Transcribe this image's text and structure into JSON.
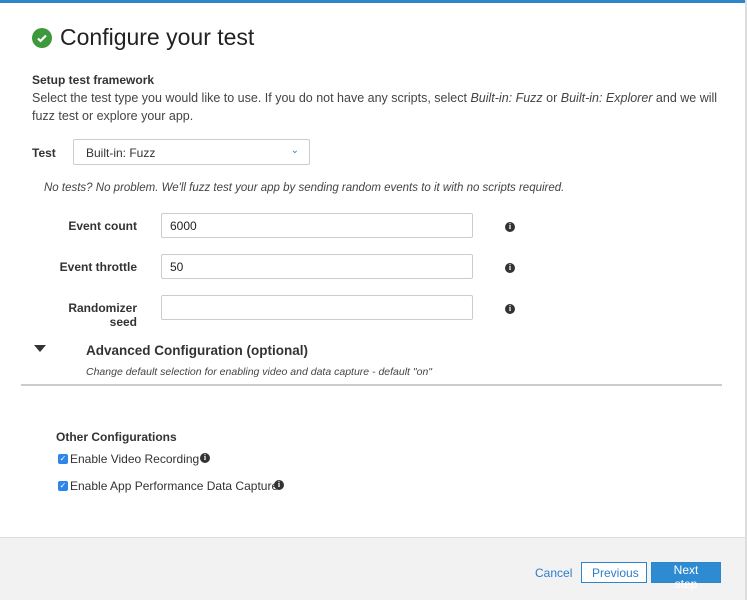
{
  "colors": {
    "accent": "#2e86c9",
    "success": "#3c9a3c"
  },
  "header": {
    "title": "Configure your test",
    "icon": "check-circle-icon"
  },
  "framework": {
    "heading": "Setup test framework",
    "description": {
      "pre": "Select the test type you would like to use. If you do not have any scripts, select ",
      "em1": "Built-in: Fuzz",
      "mid": " or ",
      "em2": "Built-in: Explorer",
      "post": " and we will fuzz test or explore your app."
    },
    "test_label": "Test",
    "test_value": "Built-in: Fuzz",
    "note": "No tests? No problem. We'll fuzz test your app by sending random events to it with no scripts required."
  },
  "fields": [
    {
      "label": "Event count",
      "value": "6000"
    },
    {
      "label": "Event throttle",
      "value": "50"
    },
    {
      "label": "Randomizer seed",
      "value": ""
    }
  ],
  "advanced": {
    "title": "Advanced Configuration (optional)",
    "subtitle": "Change default selection for enabling video and data capture - default \"on\"",
    "expanded": true
  },
  "other": {
    "heading": "Other Configurations",
    "options": [
      {
        "label": "Enable Video Recording",
        "checked": true
      },
      {
        "label": "Enable App Performance Data Capture",
        "checked": true
      }
    ]
  },
  "footer": {
    "cancel": "Cancel",
    "previous": "Previous",
    "next": "Next step"
  }
}
